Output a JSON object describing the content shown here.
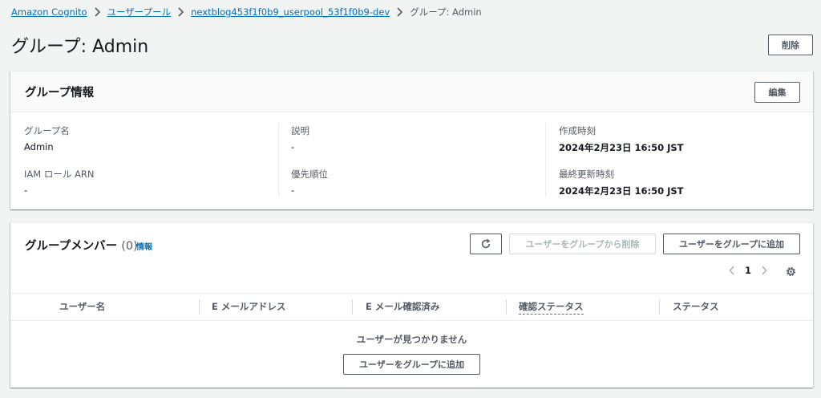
{
  "breadcrumb": {
    "items": [
      "Amazon Cognito",
      "ユーザープール",
      "nextblog453f1f0b9_userpool_53f1f0b9-dev"
    ],
    "current": "グループ: Admin"
  },
  "page": {
    "title": "グループ: Admin",
    "delete_label": "削除"
  },
  "group_info": {
    "title": "グループ情報",
    "edit_label": "編集",
    "fields": {
      "name_label": "グループ名",
      "name_value": "Admin",
      "desc_label": "説明",
      "desc_value": "-",
      "created_label": "作成時刻",
      "created_value": "2024年2月23日 16:50 JST",
      "iam_label": "IAM ロール ARN",
      "iam_value": "-",
      "precedence_label": "優先順位",
      "precedence_value": "-",
      "updated_label": "最終更新時刻",
      "updated_value": "2024年2月23日 16:50 JST"
    }
  },
  "members": {
    "title": "グループメンバー",
    "count": "(0)",
    "info_link": "情報",
    "remove_label": "ユーザーをグループから削除",
    "add_label": "ユーザーをグループに追加",
    "page_number": "1",
    "columns": [
      "ユーザー名",
      "E メールアドレス",
      "E メール確認済み",
      "確認ステータス",
      "ステータス"
    ],
    "empty_text": "ユーザーが見つかりません",
    "empty_add_label": "ユーザーをグループに追加"
  },
  "colors": {
    "link": "#0073bb",
    "background": "#f2f3f3",
    "panel_header": "#fafafa"
  }
}
